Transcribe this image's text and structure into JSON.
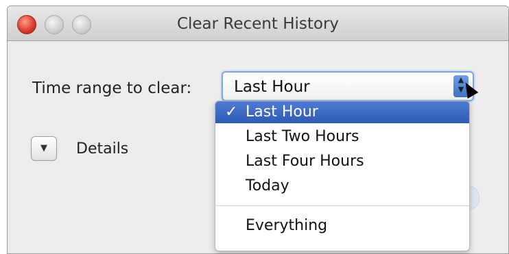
{
  "window": {
    "title": "Clear Recent History"
  },
  "form": {
    "time_range_label": "Time range to clear:",
    "time_range_value": "Last Hour",
    "details_label": "Details"
  },
  "dropdown": {
    "check": "✓",
    "options": [
      "Last Hour",
      "Last Two Hours",
      "Last Four Hours",
      "Today",
      "Everything"
    ],
    "selected": "Last Hour"
  },
  "icons": {
    "close": "close-traffic-light",
    "minimize": "minimize-traffic-light",
    "zoom": "zoom-traffic-light",
    "select_arrows": "up-down-chevron-icon",
    "disclosure": "disclosure-triangle-icon",
    "cursor": "mouse-pointer-icon"
  },
  "colors": {
    "selection": "#3f6bc4",
    "close": "#d8372a"
  }
}
